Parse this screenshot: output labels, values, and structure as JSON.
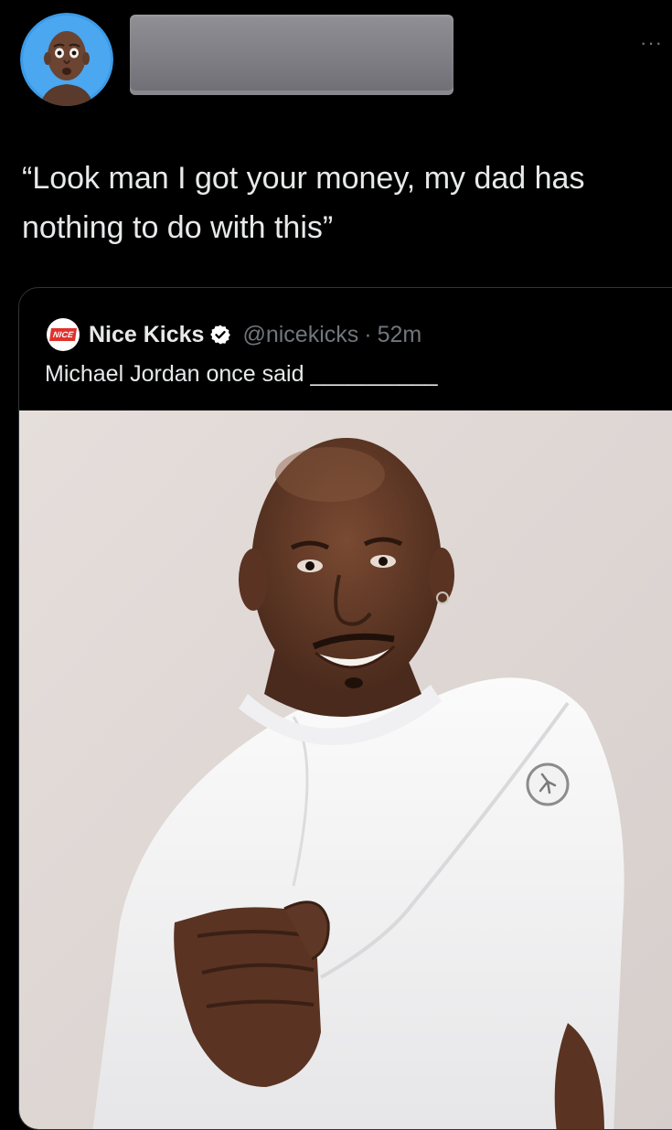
{
  "tweet": {
    "text": "“Look man I got your money, my dad has nothing to do with this”",
    "more_icon": "more-horizontal-icon",
    "avatar_icon": "user-avatar"
  },
  "quote": {
    "logo_text": "NICE",
    "name": "Nice Kicks",
    "handle": "@nicekicks",
    "separator": "·",
    "time": "52m",
    "text": "Michael Jordan once said __________",
    "verified_icon": "verified-badge-icon",
    "photo": "smiling man in white sweatshirt holding up a fist"
  },
  "colors": {
    "background": "#000000",
    "text": "#e7e9ea",
    "secondary": "#71767b",
    "border": "#2f3336",
    "brand_red": "#e0312d",
    "avatar_bg": "#3b9be8"
  }
}
